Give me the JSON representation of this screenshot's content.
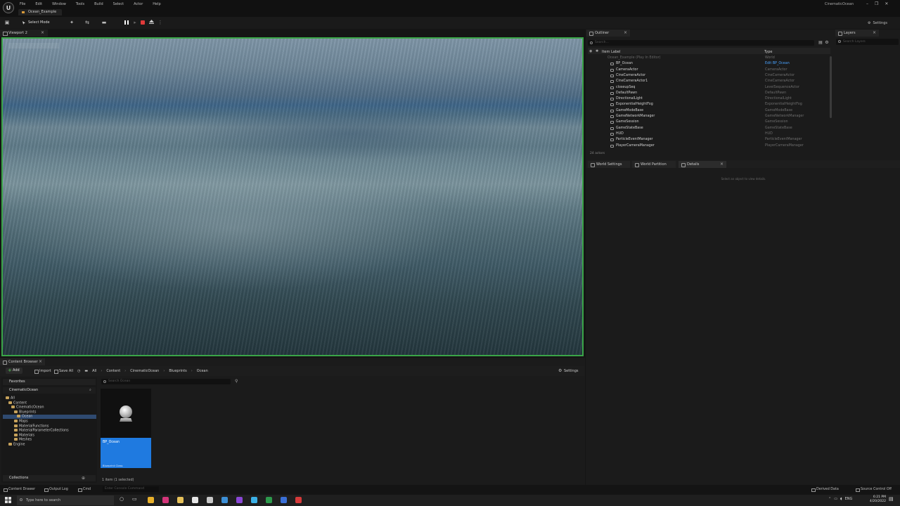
{
  "title_bar": {
    "menu": [
      "File",
      "Edit",
      "Window",
      "Tools",
      "Build",
      "Select",
      "Actor",
      "Help"
    ],
    "level_tab": "Ocean_Example",
    "project_name": "CinematicOcean",
    "controls": [
      "–",
      "❐",
      "✕"
    ]
  },
  "toolbar": {
    "select_mode": "Select Mode",
    "settings_label": "Settings"
  },
  "viewport": {
    "tab_label": "Viewport 2"
  },
  "outliner": {
    "tab_label": "Outliner",
    "search_placeholder": "Search...",
    "columns": {
      "label": "Item Label",
      "type": "Type"
    },
    "rows": [
      {
        "label": "Ocean_Example (Play In Editor)",
        "type": "World",
        "level": 0
      },
      {
        "label": "BP_Ocean",
        "type": "Edit BP_Ocean",
        "level": 1,
        "link": true
      },
      {
        "label": "CameraActor",
        "type": "CameraActor",
        "level": 1
      },
      {
        "label": "CineCameraActor",
        "type": "CineCameraActor",
        "level": 1
      },
      {
        "label": "CineCameraActor1",
        "type": "CineCameraActor",
        "level": 1
      },
      {
        "label": "closeupSeq",
        "type": "LevelSequenceActor",
        "level": 1
      },
      {
        "label": "DefaultPawn",
        "type": "DefaultPawn",
        "level": 1
      },
      {
        "label": "DirectionalLight",
        "type": "DirectionalLight",
        "level": 1
      },
      {
        "label": "ExponentialHeightFog",
        "type": "ExponentialHeightFog",
        "level": 1
      },
      {
        "label": "GameModeBase",
        "type": "GameModeBase",
        "level": 1
      },
      {
        "label": "GameNetworkManager",
        "type": "GameNetworkManager",
        "level": 1
      },
      {
        "label": "GameSession",
        "type": "GameSession",
        "level": 1
      },
      {
        "label": "GameStateBase",
        "type": "GameStateBase",
        "level": 1
      },
      {
        "label": "HUD",
        "type": "HUD",
        "level": 1
      },
      {
        "label": "ParticleEventManager",
        "type": "ParticleEventManager",
        "level": 1
      },
      {
        "label": "PlayerCameraManager",
        "type": "PlayerCameraManager",
        "level": 1
      }
    ],
    "actor_count": "24 actors"
  },
  "layers": {
    "tab_label": "Layers",
    "search_placeholder": "Search Layers"
  },
  "details_panel": {
    "tabs": [
      "World Settings",
      "World Partition",
      "Details"
    ],
    "empty_message": "Select an object to view details."
  },
  "content_browser": {
    "tab_label": "Content Browser",
    "add_label": "Add",
    "import_label": "Import",
    "save_all_label": "Save All",
    "breadcrumb": [
      "All",
      "Content",
      "CinematicOcean",
      "Blueprints",
      "Ocean"
    ],
    "settings_label": "Settings",
    "favorites_label": "Favorites",
    "project_root": "CinematicOcean",
    "collections_label": "Collections",
    "tree": [
      {
        "label": "All",
        "indent": 0
      },
      {
        "label": "Content",
        "indent": 1
      },
      {
        "label": "CinematicOcean",
        "indent": 2
      },
      {
        "label": "Blueprints",
        "indent": 3
      },
      {
        "label": "Ocean",
        "indent": 4
      },
      {
        "label": "Maps",
        "indent": 3
      },
      {
        "label": "MaterialFunctions",
        "indent": 3
      },
      {
        "label": "MaterialParameterCollections",
        "indent": 3
      },
      {
        "label": "Materials",
        "indent": 3
      },
      {
        "label": "Meshes",
        "indent": 3
      },
      {
        "label": "Engine",
        "indent": 1
      }
    ],
    "search_placeholder": "Search Ocean",
    "asset": {
      "name": "BP_Ocean",
      "class": "Blueprint Class"
    },
    "item_count": "1 item (1 selected)"
  },
  "status_bar": {
    "content_drawer": "Content Drawer",
    "output_log": "Output Log",
    "cmd": "Cmd",
    "console_placeholder": "Enter Console Command",
    "derived_data": "Derived Data",
    "source_control": "Source Control Off"
  },
  "taskbar": {
    "search_placeholder": "Type here to search",
    "apps": [
      {
        "name": "chrome",
        "color": "#e8b02a"
      },
      {
        "name": "firefox",
        "color": "#d4357a"
      },
      {
        "name": "file-explorer",
        "color": "#e7c25a"
      },
      {
        "name": "unreal",
        "color": "#e6e6e6"
      },
      {
        "name": "settings",
        "color": "#c8c8c8"
      },
      {
        "name": "steam",
        "color": "#3c8fd6"
      },
      {
        "name": "media",
        "color": "#8a47d6"
      },
      {
        "name": "notes",
        "color": "#3bb0e6"
      },
      {
        "name": "excel",
        "color": "#2d9a4c"
      },
      {
        "name": "app-blue",
        "color": "#3a6fd6"
      },
      {
        "name": "app-red",
        "color": "#d63a3a"
      }
    ],
    "language": "ENG",
    "time": "6:21 PM",
    "date": "4/20/2022"
  }
}
